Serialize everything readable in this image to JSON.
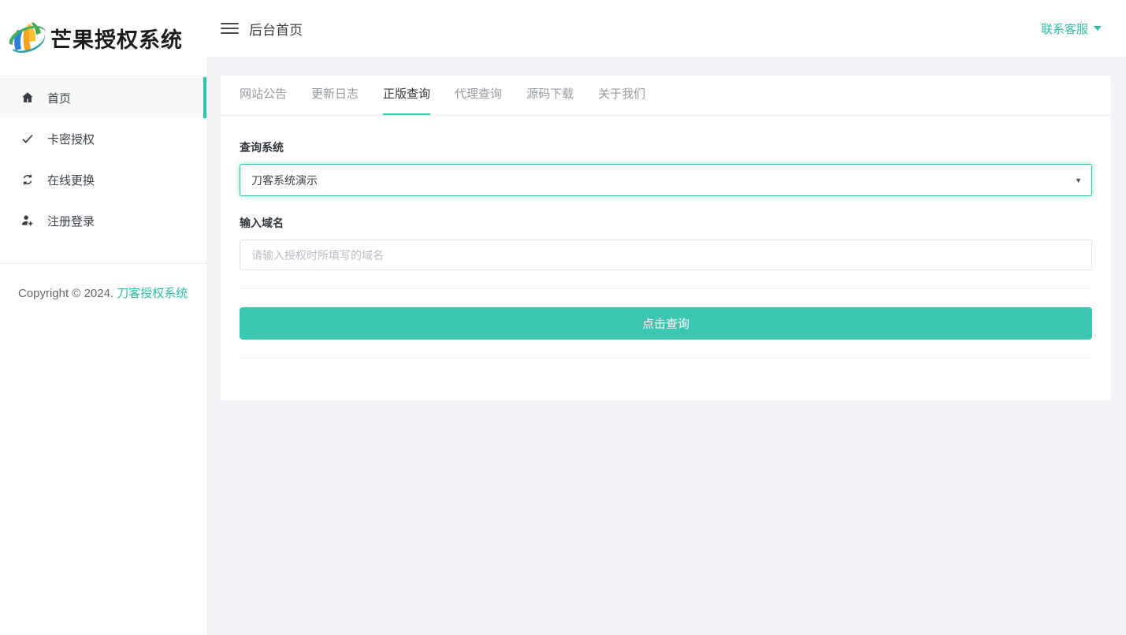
{
  "app": {
    "logo_text": "芒果授权系统",
    "colors": {
      "accent": "#2cc0a7",
      "button": "#3cc7b2",
      "select_border": "#2cc3a9",
      "active_tab_underline": "#38c6ad",
      "content_bg": "#f2f4f7"
    }
  },
  "topbar": {
    "title": "后台首页",
    "contact_label": "联系客服"
  },
  "sidebar": {
    "items": [
      {
        "label": "首页",
        "icon": "home-icon",
        "active": true
      },
      {
        "label": "卡密授权",
        "icon": "check-icon",
        "active": false
      },
      {
        "label": "在线更换",
        "icon": "sync-icon",
        "active": false
      },
      {
        "label": "注册登录",
        "icon": "user-gear-icon",
        "active": false
      }
    ],
    "copyright_prefix": "Copyright © 2024.",
    "copyright_link": "刀客授权系统"
  },
  "tabs": [
    {
      "label": "网站公告",
      "active": false
    },
    {
      "label": "更新日志",
      "active": false
    },
    {
      "label": "正版查询",
      "active": true
    },
    {
      "label": "代理查询",
      "active": false
    },
    {
      "label": "源码下载",
      "active": false
    },
    {
      "label": "关于我们",
      "active": false
    }
  ],
  "form": {
    "system_label": "查询系统",
    "system_value": "刀客系统演示",
    "select_caret": "▼",
    "domain_label": "输入域名",
    "domain_placeholder": "请输入授权时所填写的域名",
    "submit_label": "点击查询"
  }
}
